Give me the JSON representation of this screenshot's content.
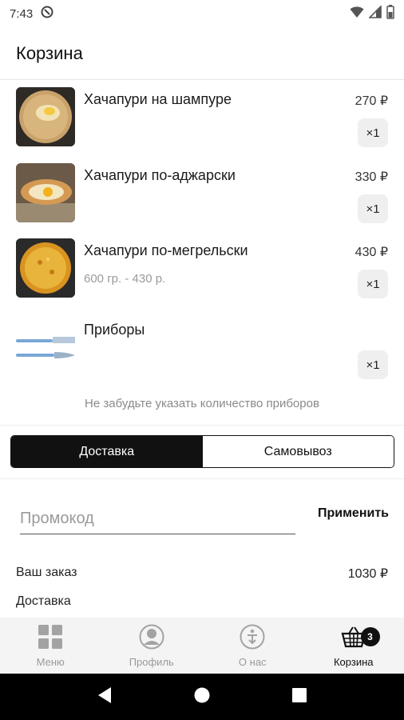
{
  "status_bar": {
    "time": "7:43"
  },
  "header": {
    "title": "Корзина"
  },
  "cart": {
    "items": [
      {
        "name": "Хачапури на шампуре",
        "subtitle": "",
        "price": "270 ₽",
        "qty": "×1"
      },
      {
        "name": "Хачапури по-аджарски",
        "subtitle": "",
        "price": "330 ₽",
        "qty": "×1"
      },
      {
        "name": "Хачапури по-мегрельски",
        "subtitle": "600 гр. - 430 р.",
        "price": "430 ₽",
        "qty": "×1"
      },
      {
        "name": "Приборы",
        "subtitle": "",
        "price": "",
        "qty": "×1"
      }
    ],
    "hint": "Не забудьте указать количество приборов"
  },
  "delivery_toggle": {
    "options": [
      "Доставка",
      "Самовывоз"
    ],
    "selected": "Доставка"
  },
  "promo": {
    "placeholder": "Промокод",
    "value": "",
    "apply_label": "Применить"
  },
  "summary": {
    "order_label": "Ваш заказ",
    "order_value": "1030 ₽",
    "delivery_label": "Доставка"
  },
  "bottom_nav": {
    "items": [
      {
        "label": "Меню",
        "icon": "grid-icon"
      },
      {
        "label": "Профиль",
        "icon": "profile-icon"
      },
      {
        "label": "О нас",
        "icon": "about-icon"
      },
      {
        "label": "Корзина",
        "icon": "basket-icon",
        "badge": "3"
      }
    ],
    "active": "Корзина"
  }
}
